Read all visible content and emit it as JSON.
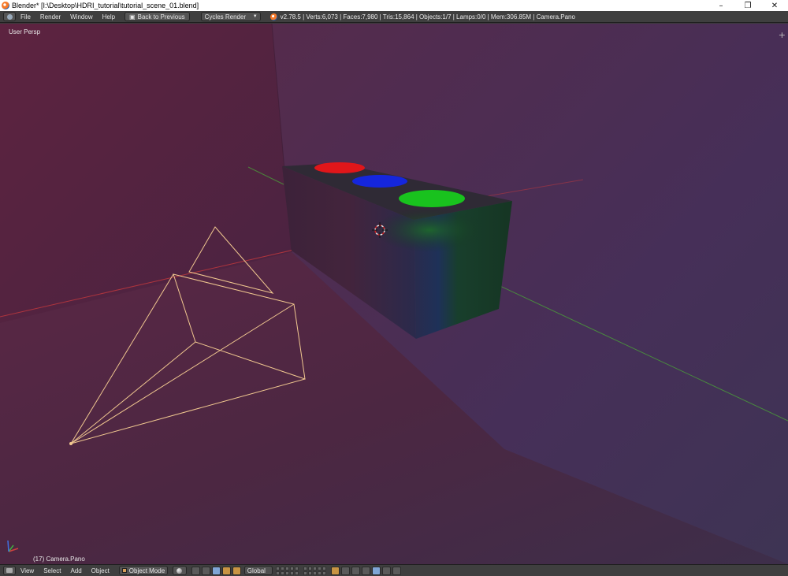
{
  "window": {
    "title": "Blender* [I:\\Desktop\\HDRI_tutorial\\tutorial_scene_01.blend]",
    "controls": {
      "minimize": "–",
      "maximize": "❐",
      "close": "✕"
    }
  },
  "info_header": {
    "menus": [
      "File",
      "Render",
      "Window",
      "Help"
    ],
    "back_button": "Back to Previous",
    "render_engine": "Cycles Render",
    "stats": "v2.78.5 | Verts:6,073 | Faces:7,980 | Tris:15,864 | Objects:1/7 | Lamps:0/0 | Mem:306.85M | Camera.Pano"
  },
  "viewport": {
    "view_name": "User Persp",
    "active_object_label": "(17) Camera.Pano",
    "scene_colors": {
      "left_wall": "#5a2342",
      "right_wall": "#4a2c55",
      "floor": "#4c2540",
      "box_front": "#173a26",
      "box_side": "#2a2540",
      "box_top": "#2d2934",
      "light_red": "#e0161a",
      "light_blue": "#1526dd",
      "light_green": "#19c21e",
      "camera_wire": "#f1c890",
      "axis_x": "#c5393d",
      "axis_y": "#4a9a3a"
    }
  },
  "view_header": {
    "menus": [
      "View",
      "Select",
      "Add",
      "Object"
    ],
    "mode": "Object Mode",
    "orientation": "Global"
  }
}
